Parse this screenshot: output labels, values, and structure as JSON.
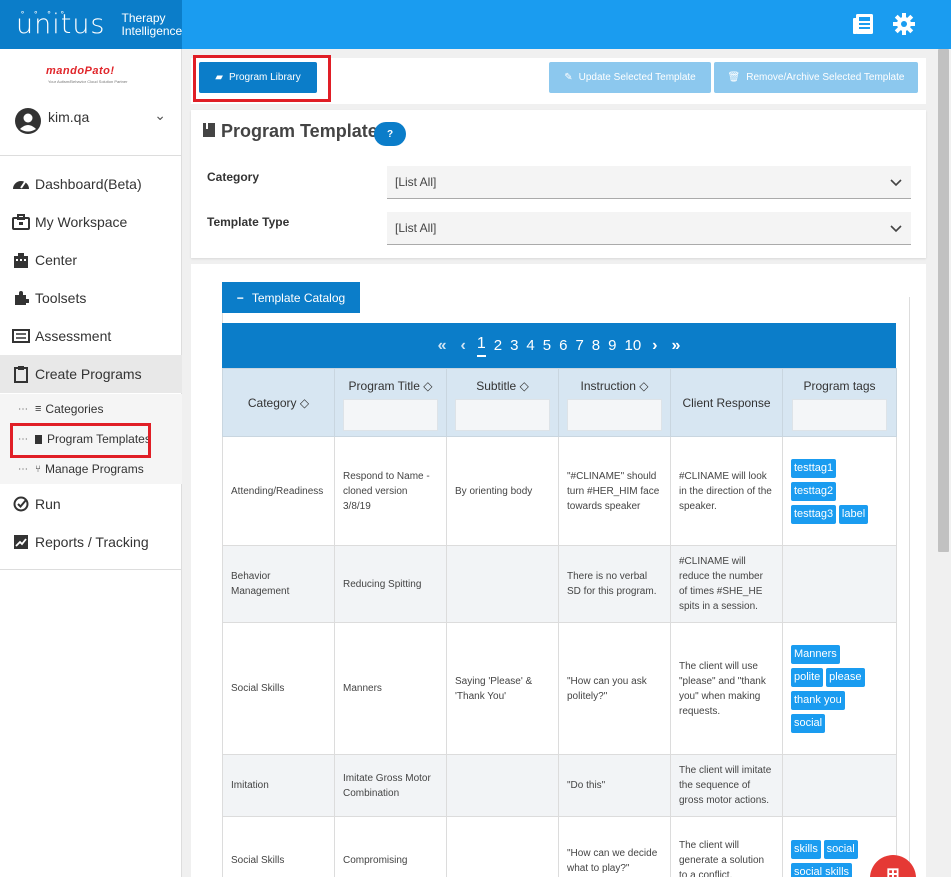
{
  "app": {
    "logo_text": "unitus",
    "logo_sub_line1": "Therapy",
    "logo_sub_line2": "Intelligence",
    "brand": "mandoPato!",
    "brand_tagline": "Your Autism/Behavior Cloud Solution Partner",
    "top_icons": [
      "news-icon",
      "gear-icon"
    ],
    "accent": "#0b7dc9",
    "accent_light": "#1a9cf0",
    "highlight": "#e01e26"
  },
  "user": {
    "name": "kim.qa"
  },
  "sidebar": {
    "items": [
      {
        "label": "Dashboard(Beta)",
        "icon": "dashboard-icon"
      },
      {
        "label": "My Workspace",
        "icon": "briefcase-icon"
      },
      {
        "label": "Center",
        "icon": "building-icon"
      },
      {
        "label": "Toolsets",
        "icon": "puzzle-icon"
      },
      {
        "label": "Assessment",
        "icon": "assessment-icon"
      },
      {
        "label": "Create Programs",
        "icon": "clipboard-icon"
      },
      {
        "label": "Run",
        "icon": "check-circle-icon"
      },
      {
        "label": "Reports / Tracking",
        "icon": "chart-icon"
      }
    ],
    "sub_items": [
      {
        "label": "Categories",
        "icon": "list-icon"
      },
      {
        "label": "Program Templates",
        "icon": "book-icon"
      },
      {
        "label": "Manage Programs",
        "icon": "branch-icon"
      }
    ]
  },
  "toolbar": {
    "program_library": "Program Library",
    "update_template": "Update Selected Template",
    "remove_template": "Remove/Archive Selected Template"
  },
  "filters": {
    "title": "Program Templates",
    "help": "?",
    "category_label": "Category",
    "category_value": "[List All]",
    "template_type_label": "Template Type",
    "template_type_value": "[List All]"
  },
  "catalog": {
    "tab_label": "Template Catalog",
    "tab_symbol": "−",
    "pager": {
      "first": "«",
      "prev": "‹",
      "pages": [
        "1",
        "2",
        "3",
        "4",
        "5",
        "6",
        "7",
        "8",
        "9",
        "10"
      ],
      "current": "1",
      "next": "›",
      "last": "»"
    },
    "columns": [
      "Category ◇",
      "Program Title ◇",
      "Subtitle ◇",
      "Instruction ◇",
      "Client Response",
      "Program tags"
    ],
    "rows": [
      {
        "category": "Attending/Readiness",
        "title": "Respond to Name - cloned version 3/8/19",
        "subtitle": "By orienting body",
        "instruction": "\"#CLINAME\" should turn #HER_HIM face towards speaker",
        "response": "#CLINAME will look in the direction of the speaker.",
        "tags": [
          "testtag1",
          "testtag2",
          "testtag3",
          "label"
        ]
      },
      {
        "category": "Behavior Management",
        "title": "Reducing Spitting",
        "subtitle": "",
        "instruction": "There is no verbal SD for this program.",
        "response": "#CLINAME will reduce the number of times #SHE_HE spits in a session.",
        "tags": []
      },
      {
        "category": "Social Skills",
        "title": "Manners",
        "subtitle": "Saying 'Please' & 'Thank You'",
        "instruction": "\"How can you ask politely?\"",
        "response": "The client will use \"please\" and \"thank you\" when making requests.",
        "tags": [
          "Manners",
          "polite",
          "please",
          "thank you",
          "social"
        ]
      },
      {
        "category": "Imitation",
        "title": "Imitate Gross Motor Combination",
        "subtitle": "",
        "instruction": "\"Do this\"",
        "response": "The client will imitate the sequence of gross motor actions.",
        "tags": []
      },
      {
        "category": "Social Skills",
        "title": "Compromising",
        "subtitle": "",
        "instruction": "\"How can we decide what to play?\"",
        "response": "The client will generate a solution to a conflict.",
        "tags": [
          "skills",
          "social",
          "social skills"
        ]
      }
    ]
  }
}
